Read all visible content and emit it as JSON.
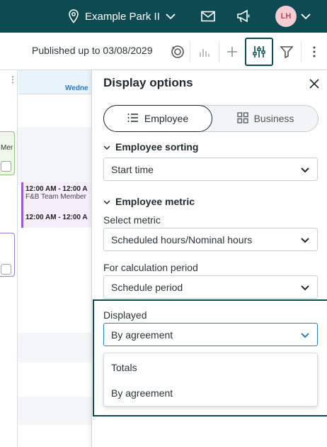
{
  "topbar": {
    "location": "Example Park II",
    "avatar_initials": "LH",
    "icons": [
      "location-pin-icon",
      "chevron-down-icon",
      "mail-icon",
      "megaphone-icon",
      "chevron-down-icon"
    ]
  },
  "toolbar": {
    "published_label": "Published up to 03/08/2029",
    "icons": [
      "history-icon",
      "chart-icon",
      "add-icon",
      "sliders-icon",
      "filter-icon",
      "more-icon"
    ]
  },
  "calendar": {
    "day_header": "Wedne",
    "green_shift_text": "Mer",
    "events": [
      {
        "time": "12:00 AM - 12:00 A",
        "role": "F&B Team Member"
      },
      {
        "time": "12:00 AM - 12:00 A",
        "role": ""
      }
    ]
  },
  "panel": {
    "title": "Display options",
    "segments": {
      "employee": "Employee",
      "business": "Business",
      "selected": "Employee"
    },
    "employee_sorting": {
      "heading": "Employee sorting",
      "value": "Start time"
    },
    "employee_metric": {
      "heading": "Employee metric",
      "select_metric_label": "Select metric",
      "select_metric_value": "Scheduled hours/Nominal hours",
      "calc_period_label": "For calculation period",
      "calc_period_value": "Schedule period",
      "displayed_label": "Displayed",
      "displayed_value": "By agreement",
      "displayed_options": [
        "Totals",
        "By agreement"
      ]
    }
  },
  "colors": {
    "topbar_bg": "#0e4a52",
    "focus_border": "#2d7fbd",
    "highlight_border": "#0e4a52"
  }
}
